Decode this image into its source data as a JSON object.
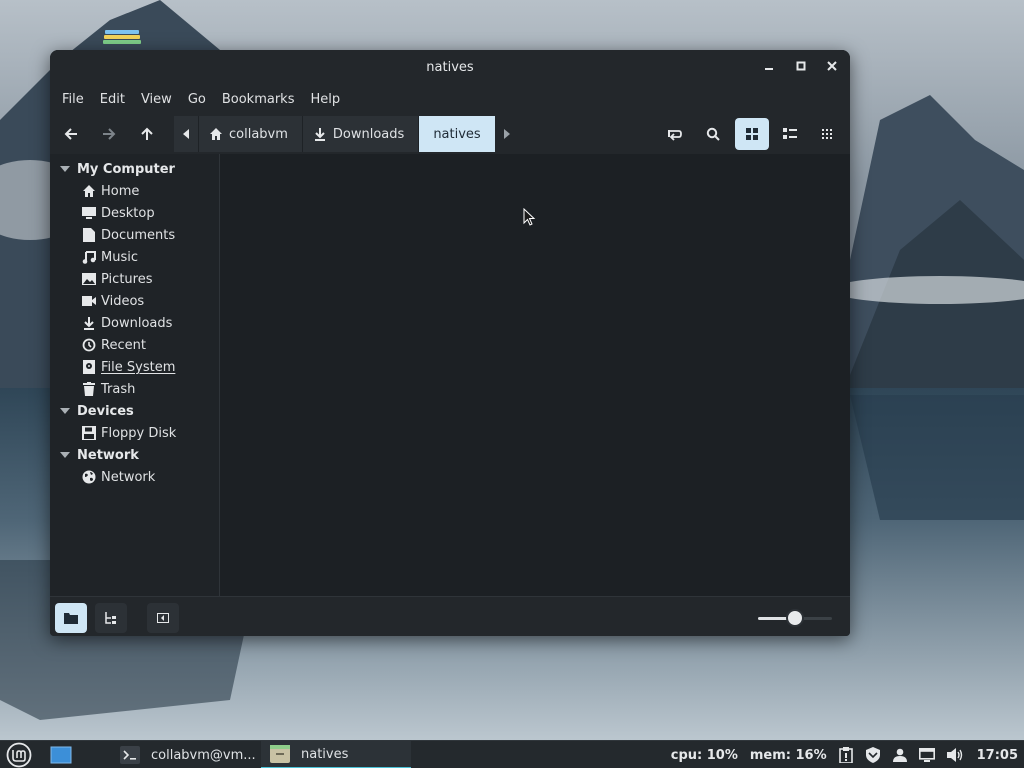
{
  "window": {
    "title": "natives",
    "controls": {
      "minimize": "minimize-icon",
      "maximize": "maximize-icon",
      "close": "close-icon"
    }
  },
  "menubar": [
    "File",
    "Edit",
    "View",
    "Go",
    "Bookmarks",
    "Help"
  ],
  "toolbar": {
    "nav_icons": [
      "arrow-left-icon",
      "arrow-right-icon",
      "arrow-up-icon"
    ],
    "breadcrumbs": [
      {
        "label": "collabvm",
        "icon": "home-icon"
      },
      {
        "label": "Downloads",
        "icon": "download-icon"
      },
      {
        "label": "natives",
        "icon": ""
      }
    ],
    "right_icons": [
      "toggle-location-icon",
      "search-icon",
      "icon-view-icon",
      "list-view-icon",
      "compact-view-icon"
    ],
    "active_view": "icon-view"
  },
  "sidebar": {
    "sections": [
      {
        "title": "My Computer",
        "items": [
          {
            "label": "Home",
            "icon": "home-icon"
          },
          {
            "label": "Desktop",
            "icon": "desktop-icon"
          },
          {
            "label": "Documents",
            "icon": "document-icon"
          },
          {
            "label": "Music",
            "icon": "music-icon"
          },
          {
            "label": "Pictures",
            "icon": "picture-icon"
          },
          {
            "label": "Videos",
            "icon": "video-icon"
          },
          {
            "label": "Downloads",
            "icon": "download-icon"
          },
          {
            "label": "Recent",
            "icon": "recent-icon"
          },
          {
            "label": "File System",
            "icon": "drive-icon"
          },
          {
            "label": "Trash",
            "icon": "trash-icon"
          }
        ]
      },
      {
        "title": "Devices",
        "items": [
          {
            "label": "Floppy Disk",
            "icon": "floppy-icon"
          }
        ]
      },
      {
        "title": "Network",
        "items": [
          {
            "label": "Network",
            "icon": "globe-icon"
          }
        ]
      }
    ]
  },
  "statusbar": {
    "buttons": [
      "places-icon",
      "tree-icon",
      "hide-sidebar-icon"
    ],
    "zoom_level": 0.5
  },
  "taskbar": {
    "menu_icon": "mint-logo-icon",
    "show_desktop_icon": "show-desktop-icon",
    "tasks": [
      {
        "label": "collabvm@vm...",
        "icon": "terminal-icon",
        "active": false
      },
      {
        "label": "natives",
        "icon": "folder-icon",
        "active": true
      }
    ],
    "cpu": "cpu: 10%",
    "mem": "mem: 16%",
    "tray_icons": [
      "clipboard-icon",
      "shield-icon",
      "user-icon",
      "display-icon",
      "volume-icon"
    ],
    "clock": "17:05"
  },
  "colors": {
    "accent": "#cfe6f5",
    "active_task_underline": "#4ac2d6",
    "window_bg": "#1e2226"
  }
}
